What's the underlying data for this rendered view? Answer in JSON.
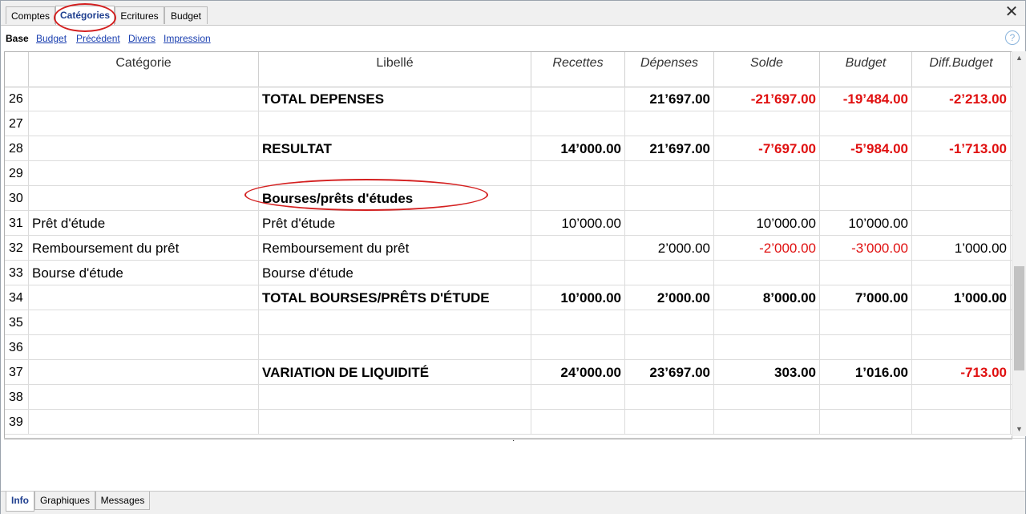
{
  "tabs": {
    "comptes": "Comptes",
    "categories": "Catégories",
    "ecritures": "Ecritures",
    "budget": "Budget"
  },
  "subtabs": {
    "base": "Base",
    "budget": "Budget",
    "precedent": "Précédent",
    "divers": "Divers",
    "impression": "Impression"
  },
  "icons": {
    "close": "close-icon",
    "help": "help-icon"
  },
  "columns": {
    "categorie": "Catégorie",
    "libelle": "Libellé",
    "recettes": "Recettes",
    "depenses": "Dépenses",
    "solde": "Solde",
    "budget": "Budget",
    "diff": "Diff.Budget"
  },
  "rows": [
    {
      "n": "26",
      "cat": "",
      "lib": "TOTAL DEPENSES",
      "rec": "",
      "dep": "21’697.00",
      "sol": "-21’697.00",
      "bud": "-19’484.00",
      "diff": "-2’213.00"
    },
    {
      "n": "27",
      "cat": "",
      "lib": "",
      "rec": "",
      "dep": "",
      "sol": "",
      "bud": "",
      "diff": ""
    },
    {
      "n": "28",
      "cat": "",
      "lib": "RESULTAT",
      "rec": "14’000.00",
      "dep": "21’697.00",
      "sol": "-7’697.00",
      "bud": "-5’984.00",
      "diff": "-1’713.00"
    },
    {
      "n": "29",
      "cat": "",
      "lib": "",
      "rec": "",
      "dep": "",
      "sol": "",
      "bud": "",
      "diff": ""
    },
    {
      "n": "30",
      "cat": "",
      "lib": "Bourses/prêts d'études",
      "rec": "",
      "dep": "",
      "sol": "",
      "bud": "",
      "diff": ""
    },
    {
      "n": "31",
      "cat": "Prêt d'étude",
      "lib": "Prêt d'étude",
      "rec": "10’000.00",
      "dep": "",
      "sol": "10’000.00",
      "bud": "10’000.00",
      "diff": ""
    },
    {
      "n": "32",
      "cat": "Remboursement du prêt",
      "lib": "Remboursement du prêt",
      "rec": "",
      "dep": "2’000.00",
      "sol": "-2’000.00",
      "bud": "-3’000.00",
      "diff": "1’000.00"
    },
    {
      "n": "33",
      "cat": "Bourse d'étude",
      "lib": "Bourse d'étude",
      "rec": "",
      "dep": "",
      "sol": "",
      "bud": "",
      "diff": ""
    },
    {
      "n": "34",
      "cat": "",
      "lib": "TOTAL BOURSES/PRÊTS D'ÉTUDE",
      "rec": "10’000.00",
      "dep": "2’000.00",
      "sol": "8’000.00",
      "bud": "7’000.00",
      "diff": "1’000.00"
    },
    {
      "n": "35",
      "cat": "",
      "lib": "",
      "rec": "",
      "dep": "",
      "sol": "",
      "bud": "",
      "diff": ""
    },
    {
      "n": "36",
      "cat": "",
      "lib": "",
      "rec": "",
      "dep": "",
      "sol": "",
      "bud": "",
      "diff": ""
    },
    {
      "n": "37",
      "cat": "",
      "lib": "VARIATION DE LIQUIDITÉ",
      "rec": "24’000.00",
      "dep": "23’697.00",
      "sol": "303.00",
      "bud": "1’016.00",
      "diff": "-713.00"
    },
    {
      "n": "38",
      "cat": "",
      "lib": "",
      "rec": "",
      "dep": "",
      "sol": "",
      "bud": "",
      "diff": ""
    },
    {
      "n": "39",
      "cat": "",
      "lib": "",
      "rec": "",
      "dep": "",
      "sol": "",
      "bud": "",
      "diff": ""
    }
  ],
  "bottom_tabs": {
    "info": "Info",
    "graphiques": "Graphiques",
    "messages": "Messages"
  },
  "colors": {
    "negative": "#e01010",
    "active_tab": "#1f3f8f",
    "link": "#1a3fb0",
    "highlight": "#d42020"
  }
}
